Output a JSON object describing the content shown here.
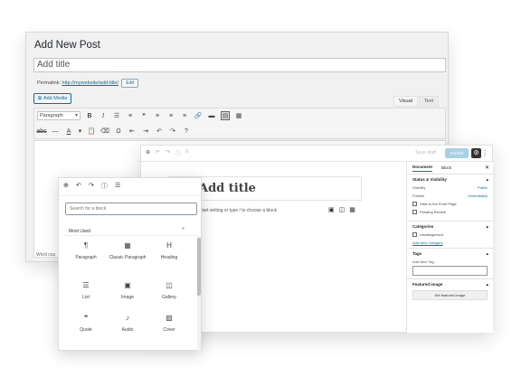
{
  "classic": {
    "heading": "Add New Post",
    "title_placeholder": "Add title",
    "permalink_label": "Permalink:",
    "permalink_url": "http://mywebsite/add-title/",
    "edit_label": "Edit",
    "add_media": "Add Media",
    "tabs": [
      "Visual",
      "Text"
    ],
    "format_select": "Paragraph",
    "word_count": "Word cou"
  },
  "block_editor": {
    "title_text": "Add title",
    "prompt": "Start writing or type / to choose a block",
    "save_draft": "Save draft",
    "publish": "Publish",
    "sidebar": {
      "tabs": [
        "Document",
        "Block"
      ],
      "status": {
        "title": "Status & Visibility",
        "visibility_label": "Visibility",
        "visibility_value": "Public",
        "publish_label": "Publish",
        "publish_value": "Immediately",
        "stick": "Stick to the Front Page",
        "pending": "Pending Review"
      },
      "categories": {
        "title": "Categories",
        "uncategorized": "Uncategorized",
        "add_new": "Add New Category"
      },
      "tags": {
        "title": "Tags",
        "add_new_label": "Add New Tag"
      },
      "featured_image": {
        "title": "Featured image",
        "button": "Set featured image"
      }
    }
  },
  "inserter": {
    "search_placeholder": "Search for a block",
    "section_title": "Most Used",
    "blocks": [
      {
        "label": "Paragraph",
        "icon": "¶"
      },
      {
        "label": "Classic Paragraph",
        "icon": "▦"
      },
      {
        "label": "Heading",
        "icon": "H"
      },
      {
        "label": "List",
        "icon": "☰"
      },
      {
        "label": "Image",
        "icon": "▣"
      },
      {
        "label": "Gallery",
        "icon": "◫"
      },
      {
        "label": "Quote",
        "icon": "❝"
      },
      {
        "label": "Audio",
        "icon": "♪"
      },
      {
        "label": "Cover",
        "icon": "▨"
      }
    ]
  },
  "colors": {
    "accent": "#0073aa",
    "publish_disabled": "#a7d1e6"
  }
}
